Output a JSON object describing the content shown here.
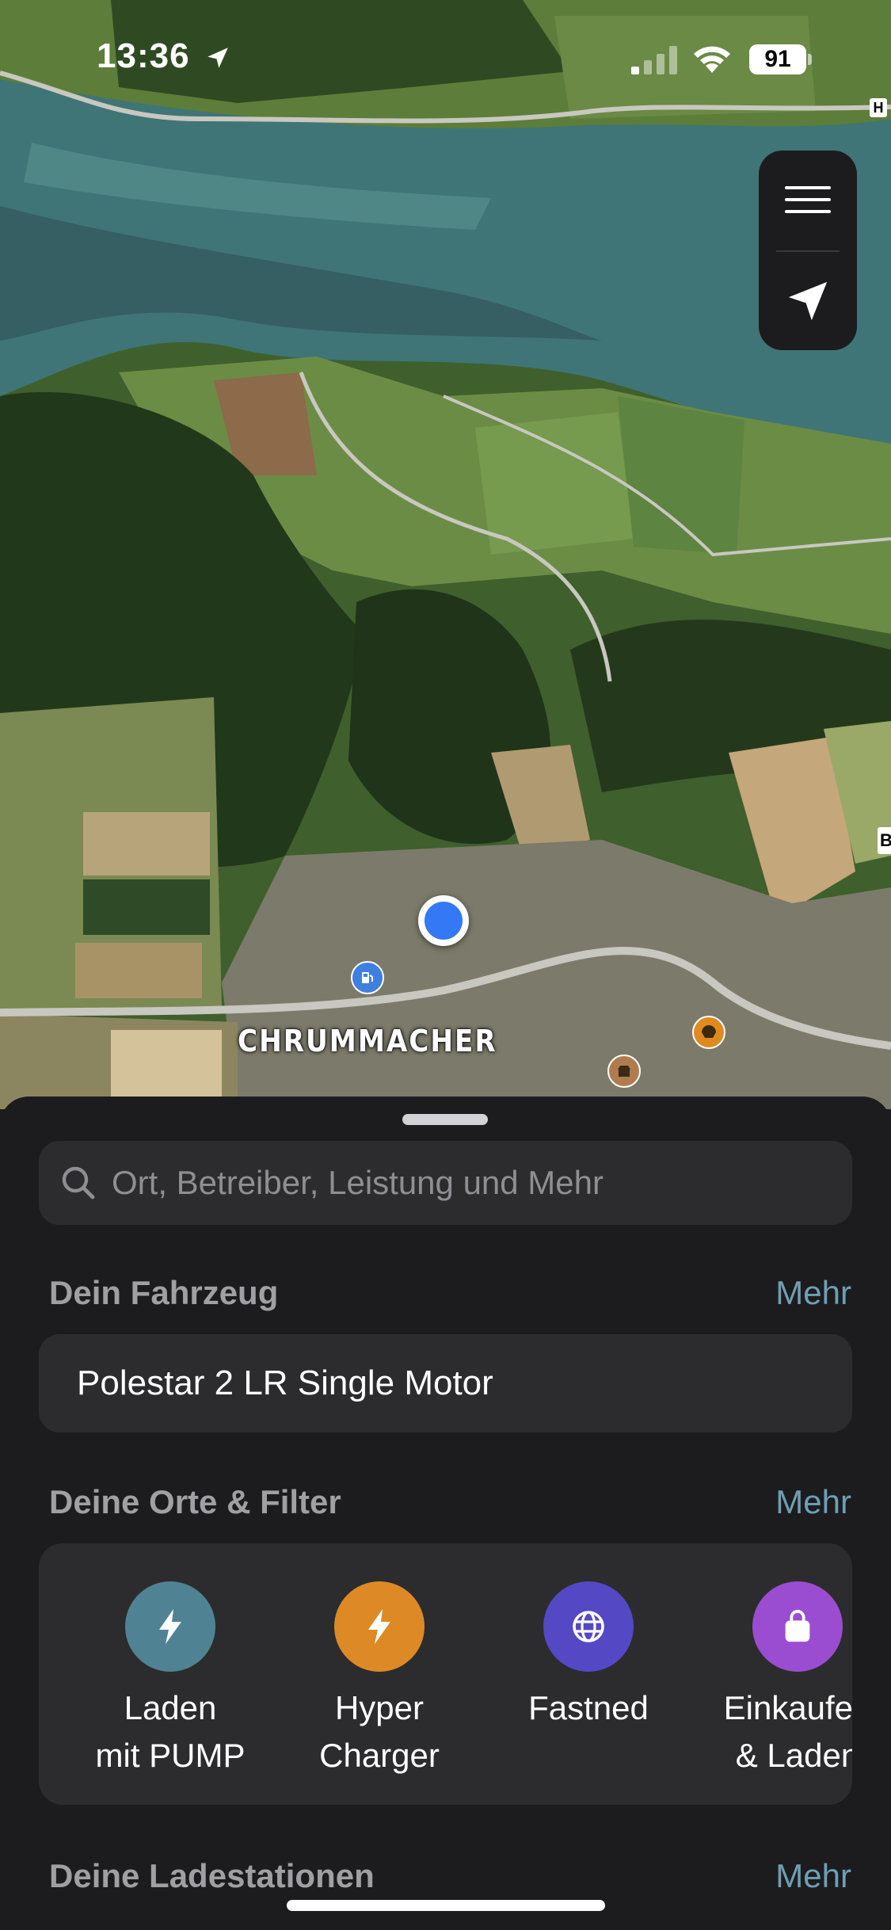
{
  "status_bar": {
    "time": "13:36",
    "battery": "91"
  },
  "map": {
    "place_label": "CHRUMMACHER",
    "edge_labels": [
      "H",
      "B"
    ]
  },
  "search": {
    "placeholder": "Ort, Betreiber, Leistung und Mehr"
  },
  "vehicle_section": {
    "title": "Dein Fahrzeug",
    "more": "Mehr",
    "vehicle": "Polestar 2 LR Single Motor"
  },
  "filters_section": {
    "title": "Deine Orte & Filter",
    "more": "Mehr",
    "items": [
      {
        "label": "Laden\nmit PUMP",
        "icon": "bolt-icon",
        "color": "#4f8393"
      },
      {
        "label": "Hyper\nCharger",
        "icon": "bolt-icon",
        "color": "#dd8a26"
      },
      {
        "label": "Fastned",
        "icon": "globe-icon",
        "color": "#5448c4"
      },
      {
        "label": "Einkaufen\n& Laden",
        "icon": "shopping-bag-icon",
        "color": "#9b4dd1"
      }
    ]
  },
  "stations_section": {
    "title": "Deine Ladestationen",
    "more": "Mehr"
  }
}
